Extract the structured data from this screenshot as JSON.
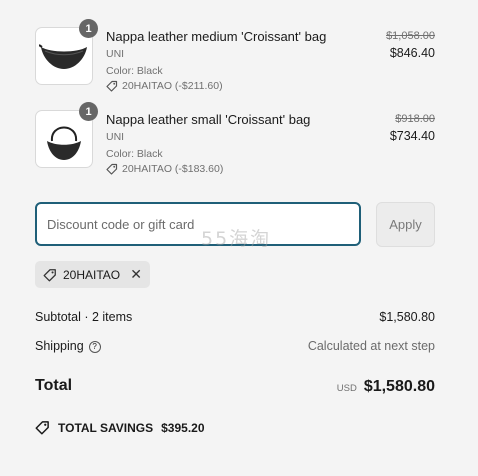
{
  "items": [
    {
      "quantity": "1",
      "name": "Nappa leather medium 'Croissant' bag",
      "variant": "UNI",
      "color": "Color: Black",
      "discount": "20HAITAO (-$211.60)",
      "original_price": "$1,058.00",
      "price": "$846.40",
      "image_icon": "crossbody-bag-image"
    },
    {
      "quantity": "1",
      "name": "Nappa leather small 'Croissant' bag",
      "variant": "UNI",
      "color": "Color: Black",
      "discount": "20HAITAO (-$183.60)",
      "original_price": "$918.00",
      "price": "$734.40",
      "image_icon": "shoulder-bag-image"
    }
  ],
  "discount": {
    "placeholder": "Discount code or gift card",
    "apply_label": "Apply",
    "applied_code": "20HAITAO",
    "watermark": "55海淘"
  },
  "summary": {
    "subtotal_label": "Subtotal · 2 items",
    "subtotal_value": "$1,580.80",
    "shipping_label": "Shipping",
    "shipping_value": "Calculated at next step",
    "total_label": "Total",
    "currency": "USD",
    "total_value": "$1,580.80",
    "savings_label": "TOTAL SAVINGS",
    "savings_value": "$395.20"
  },
  "colors": {
    "background": "#f4f4f4",
    "input_border": "#1f5f78",
    "badge": "#666666",
    "muted_text": "#707070"
  }
}
